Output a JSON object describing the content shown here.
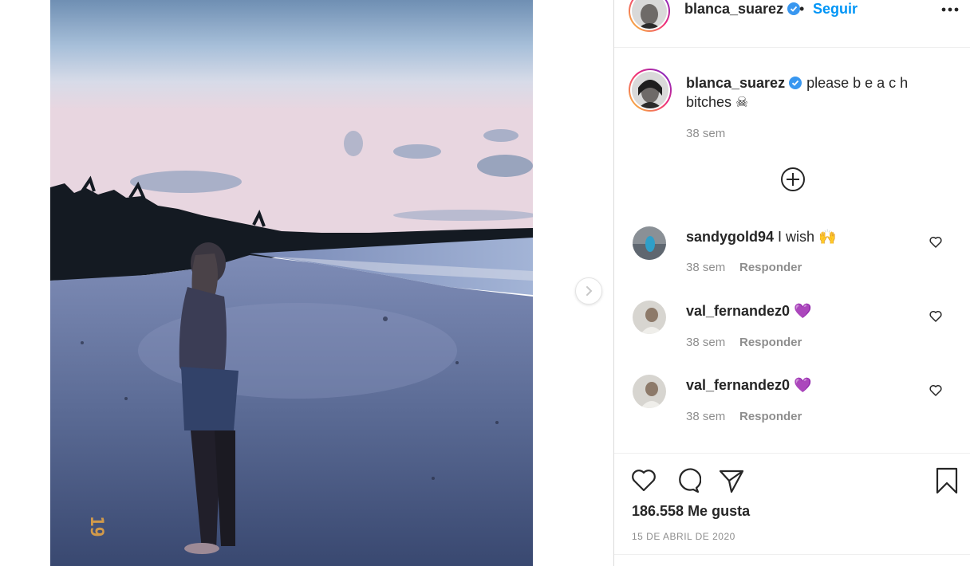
{
  "post": {
    "author": "blanca_suarez",
    "separator": "•",
    "follow_label": "Seguir",
    "caption_text": "please b e a c h bitches ☠",
    "caption_age": "38 sem",
    "date_stamp": "19"
  },
  "comments": [
    {
      "user": "sandygold94",
      "text": "I wish 🙌",
      "age": "38 sem",
      "reply": "Responder"
    },
    {
      "user": "val_fernandez0",
      "text": "💜",
      "age": "38 sem",
      "reply": "Responder"
    },
    {
      "user": "val_fernandez0",
      "text": "💜",
      "age": "38 sem",
      "reply": "Responder"
    }
  ],
  "stats": {
    "likes": "186.558 Me gusta",
    "date": "15 DE ABRIL DE 2020"
  },
  "icons": {
    "verified": "verified-badge-icon",
    "more": "more-options-icon",
    "next": "chevron-right-icon",
    "load_more": "plus-circle-icon",
    "like": "heart-icon",
    "comment": "comment-icon",
    "share": "paper-plane-icon",
    "save": "bookmark-icon"
  },
  "colors": {
    "accent": "#0095f6",
    "verified": "#3897f0",
    "muted": "#8e8e8e",
    "text": "#262626"
  }
}
